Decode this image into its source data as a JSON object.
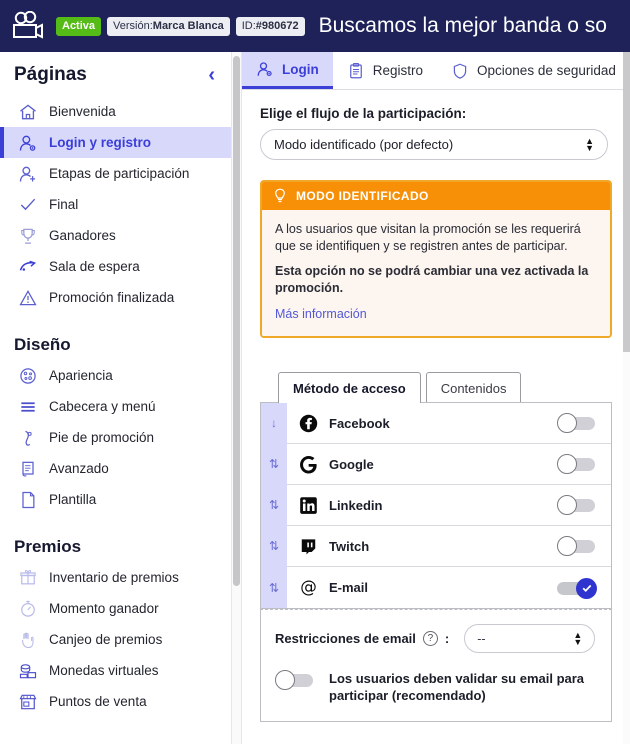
{
  "colors": {
    "brand_navy": "#1e2259",
    "accent_indigo": "#3b3fd8",
    "active_bg": "#d8d8fb",
    "status_green": "#55bb16",
    "callout_orange": "#f79007",
    "callout_border": "#efa827",
    "callout_bg": "#fdf5ef",
    "toggle_on": "#2f34cf"
  },
  "topbar": {
    "logo_icon": "video-camera-icon",
    "status_badge": "Activa",
    "version_prefix": "Versión: ",
    "version_value": "Marca Blanca",
    "id_prefix": "ID: ",
    "id_value": "#980672",
    "promo_title": "Buscamos la mejor banda o so"
  },
  "sidebar": {
    "header": {
      "title": "Páginas",
      "collapse_icon": "chevron-left-icon"
    },
    "groups": [
      {
        "title": "Páginas",
        "items": [
          {
            "label": "Bienvenida",
            "icon": "home-icon",
            "active": false,
            "faded": false
          },
          {
            "label": "Login y registro",
            "icon": "user-login-icon",
            "active": true,
            "faded": false
          },
          {
            "label": "Etapas de participación",
            "icon": "user-add-icon",
            "active": false,
            "faded": false
          },
          {
            "label": "Final",
            "icon": "check-badge-icon",
            "active": false,
            "faded": false
          },
          {
            "label": "Ganadores",
            "icon": "trophy-icon",
            "active": false,
            "faded": false
          },
          {
            "label": "Sala de espera",
            "icon": "waiting-room-icon",
            "active": false,
            "faded": false
          },
          {
            "label": "Promoción finalizada",
            "icon": "warning-triangle-icon",
            "active": false,
            "faded": false
          }
        ]
      },
      {
        "title": "Diseño",
        "items": [
          {
            "label": "Apariencia",
            "icon": "palette-icon",
            "active": false,
            "faded": false
          },
          {
            "label": "Cabecera y menú",
            "icon": "menu-lines-icon",
            "active": false,
            "faded": false
          },
          {
            "label": "Pie de promoción",
            "icon": "footer-icon",
            "active": false,
            "faded": false
          },
          {
            "label": "Avanzado",
            "icon": "scroll-document-icon",
            "active": false,
            "faded": false
          },
          {
            "label": "Plantilla",
            "icon": "page-icon",
            "active": false,
            "faded": false
          }
        ]
      },
      {
        "title": "Premios",
        "items": [
          {
            "label": "Inventario de premios",
            "icon": "gift-icon",
            "active": false,
            "faded": true
          },
          {
            "label": "Momento ganador",
            "icon": "stopwatch-icon",
            "active": false,
            "faded": true
          },
          {
            "label": "Canjeo de premios",
            "icon": "redeem-hand-icon",
            "active": false,
            "faded": true
          },
          {
            "label": "Monedas virtuales",
            "icon": "coins-icon",
            "active": false,
            "faded": false
          },
          {
            "label": "Puntos de venta",
            "icon": "store-icon",
            "active": false,
            "faded": false
          }
        ]
      }
    ]
  },
  "main": {
    "tabs": [
      {
        "label": "Login",
        "icon": "user-login-icon",
        "active": true
      },
      {
        "label": "Registro",
        "icon": "clipboard-icon",
        "active": false
      },
      {
        "label": "Opciones de seguridad",
        "icon": "shield-icon",
        "active": false
      }
    ],
    "flow": {
      "label": "Elige el flujo de la participación:",
      "selected": "Modo identificado (por defecto)"
    },
    "callout": {
      "icon": "lightbulb-icon",
      "title": "MODO IDENTIFICADO",
      "paragraph_1": "A los usuarios que visitan la promoción se les requerirá que se identifiquen y se registren antes de participar.",
      "paragraph_2": "Esta opción no se podrá cambiar una vez activada la promoción.",
      "link": "Más información"
    },
    "inner_tabs": [
      {
        "label": "Método de acceso",
        "active": true
      },
      {
        "label": "Contenidos",
        "active": false
      }
    ],
    "providers": [
      {
        "name": "Facebook",
        "icon": "facebook-icon",
        "enabled": false,
        "drag": "arrow-down-icon"
      },
      {
        "name": "Google",
        "icon": "google-icon",
        "enabled": false,
        "drag": "arrow-up-down-icon"
      },
      {
        "name": "Linkedin",
        "icon": "linkedin-icon",
        "enabled": false,
        "drag": "arrow-up-down-icon"
      },
      {
        "name": "Twitch",
        "icon": "twitch-icon",
        "enabled": false,
        "drag": "arrow-up-down-icon"
      },
      {
        "name": "E-mail",
        "icon": "at-sign-icon",
        "enabled": true,
        "drag": "arrow-up-down-icon"
      }
    ],
    "email_restrictions": {
      "label": "Restricciones de email",
      "help_icon": "question-circle-icon",
      "colon": ":",
      "selected": "--"
    },
    "validate_email": {
      "label": "Los usuarios deben validar su email para participar (recomendado)",
      "enabled": false
    }
  }
}
